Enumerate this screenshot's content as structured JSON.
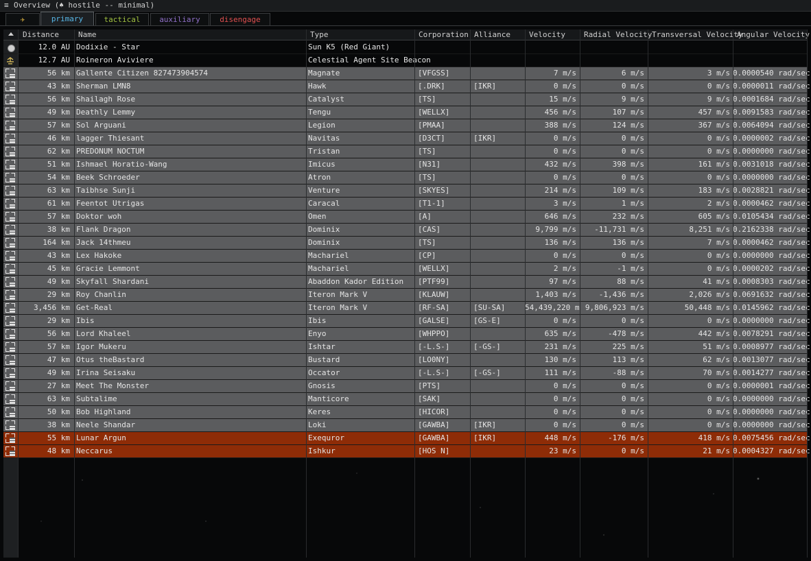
{
  "window": {
    "menu_glyph": "≡",
    "title": "Overview (♠ hostile -- minimal)"
  },
  "tabs": [
    {
      "label": "✈",
      "color": "#d8b040"
    },
    {
      "label": "primary",
      "color": "#58b8e8"
    },
    {
      "label": "tactical",
      "color": "#a0c040"
    },
    {
      "label": "auxiliary",
      "color": "#9070c8"
    },
    {
      "label": "disengage",
      "color": "#e05050"
    }
  ],
  "columns": {
    "distance": "Distance",
    "name": "Name",
    "type": "Type",
    "corporation": "Corporation",
    "alliance": "Alliance",
    "velocity": "Velocity",
    "radial": "Radial Velocity",
    "transversal": "Transversal Velocity",
    "angular": "Angular Velocity"
  },
  "rows": [
    {
      "icon": "star-icon",
      "style": "plain",
      "distance": "12.0 AU",
      "name": "Dodixie - Star",
      "type": "Sun K5 (Red Giant)",
      "corp": "",
      "alliance": "",
      "velocity": "",
      "radial": "",
      "transversal": "",
      "angular": ""
    },
    {
      "icon": "beacon-icon",
      "style": "plain",
      "distance": "12.7 AU",
      "name": "Roineron Aviviere",
      "type": "Celestial Agent Site Beacon",
      "corp": "",
      "alliance": "",
      "velocity": "",
      "radial": "",
      "transversal": "",
      "angular": ""
    },
    {
      "icon": "ship-icon",
      "style": "grey",
      "distance": "56 km",
      "name": "Gallente Citizen 827473904574",
      "type": "Magnate",
      "corp": "[VFGSS]",
      "alliance": "",
      "velocity": "7 m/s",
      "radial": "6 m/s",
      "transversal": "3 m/s",
      "angular": "0.0000540 rad/sec"
    },
    {
      "icon": "ship-icon",
      "style": "grey",
      "distance": "43 km",
      "name": "Sherman LMN8",
      "type": "Hawk",
      "corp": "[.DRK]",
      "alliance": "[IKR]",
      "velocity": "0 m/s",
      "radial": "0 m/s",
      "transversal": "0 m/s",
      "angular": "0.0000011 rad/sec"
    },
    {
      "icon": "ship-icon",
      "style": "grey",
      "distance": "56 km",
      "name": "Shailagh Rose",
      "type": "Catalyst",
      "corp": "[TS]",
      "alliance": "",
      "velocity": "15 m/s",
      "radial": "9 m/s",
      "transversal": "9 m/s",
      "angular": "0.0001684 rad/sec"
    },
    {
      "icon": "ship-icon",
      "style": "grey",
      "distance": "49 km",
      "name": "Deathly Lemmy",
      "type": "Tengu",
      "corp": "[WELLX]",
      "alliance": "",
      "velocity": "456 m/s",
      "radial": "107 m/s",
      "transversal": "457 m/s",
      "angular": "0.0091583 rad/sec"
    },
    {
      "icon": "ship-icon",
      "style": "grey",
      "distance": "57 km",
      "name": "Sol Arguani",
      "type": "Legion",
      "corp": "[PMAA]",
      "alliance": "",
      "velocity": "388 m/s",
      "radial": "124 m/s",
      "transversal": "367 m/s",
      "angular": "0.0064094 rad/sec"
    },
    {
      "icon": "ship-icon",
      "style": "grey",
      "distance": "46 km",
      "name": "lagger Thiesant",
      "type": "Navitas",
      "corp": "[D3CT]",
      "alliance": "[IKR]",
      "velocity": "0 m/s",
      "radial": "0 m/s",
      "transversal": "0 m/s",
      "angular": "0.0000002 rad/sec"
    },
    {
      "icon": "ship-icon",
      "style": "grey",
      "distance": "62 km",
      "name": "PREDONUM NOCTUM",
      "type": "Tristan",
      "corp": "[TS]",
      "alliance": "",
      "velocity": "0 m/s",
      "radial": "0 m/s",
      "transversal": "0 m/s",
      "angular": "0.0000000 rad/sec"
    },
    {
      "icon": "ship-icon",
      "style": "grey",
      "distance": "51 km",
      "name": "Ishmael Horatio-Wang",
      "type": "Imicus",
      "corp": "[N31]",
      "alliance": "",
      "velocity": "432 m/s",
      "radial": "398 m/s",
      "transversal": "161 m/s",
      "angular": "0.0031018 rad/sec"
    },
    {
      "icon": "ship-icon",
      "style": "grey",
      "distance": "54 km",
      "name": "Beek Schroeder",
      "type": "Atron",
      "corp": "[TS]",
      "alliance": "",
      "velocity": "0 m/s",
      "radial": "0 m/s",
      "transversal": "0 m/s",
      "angular": "0.0000000 rad/sec"
    },
    {
      "icon": "ship-icon",
      "style": "grey",
      "distance": "63 km",
      "name": "Taibhse Sunji",
      "type": "Venture",
      "corp": "[SKYES]",
      "alliance": "",
      "velocity": "214 m/s",
      "radial": "109 m/s",
      "transversal": "183 m/s",
      "angular": "0.0028821 rad/sec"
    },
    {
      "icon": "ship-icon",
      "style": "grey",
      "distance": "61 km",
      "name": "Feentot Utrigas",
      "type": "Caracal",
      "corp": "[T1-1]",
      "alliance": "",
      "velocity": "3 m/s",
      "radial": "1 m/s",
      "transversal": "2 m/s",
      "angular": "0.0000462 rad/sec"
    },
    {
      "icon": "ship-icon",
      "style": "grey",
      "distance": "57 km",
      "name": "Doktor woh",
      "type": "Omen",
      "corp": "[A]",
      "alliance": "",
      "velocity": "646 m/s",
      "radial": "232 m/s",
      "transversal": "605 m/s",
      "angular": "0.0105434 rad/sec"
    },
    {
      "icon": "ship-icon",
      "style": "grey",
      "distance": "38 km",
      "name": "Flank Dragon",
      "type": "Dominix",
      "corp": "[CAS]",
      "alliance": "",
      "velocity": "9,799 m/s",
      "radial": "-11,731 m/s",
      "transversal": "8,251 m/s",
      "angular": "0.2162338 rad/sec"
    },
    {
      "icon": "ship-icon",
      "style": "grey",
      "distance": "164 km",
      "name": "Jack 14thmeu",
      "type": "Dominix",
      "corp": "[TS]",
      "alliance": "",
      "velocity": "136 m/s",
      "radial": "136 m/s",
      "transversal": "7 m/s",
      "angular": "0.0000462 rad/sec"
    },
    {
      "icon": "ship-icon",
      "style": "grey",
      "distance": "43 km",
      "name": "Lex Hakoke",
      "type": "Machariel",
      "corp": "[CP]",
      "alliance": "",
      "velocity": "0 m/s",
      "radial": "0 m/s",
      "transversal": "0 m/s",
      "angular": "0.0000000 rad/sec"
    },
    {
      "icon": "ship-icon",
      "style": "grey",
      "distance": "45 km",
      "name": "Gracie Lemmont",
      "type": "Machariel",
      "corp": "[WELLX]",
      "alliance": "",
      "velocity": "2 m/s",
      "radial": "-1 m/s",
      "transversal": "0 m/s",
      "angular": "0.0000202 rad/sec"
    },
    {
      "icon": "ship-icon",
      "style": "grey",
      "distance": "49 km",
      "name": "Skyfall Shardani",
      "type": "Abaddon Kador Edition",
      "corp": "[PTF99]",
      "alliance": "",
      "velocity": "97 m/s",
      "radial": "88 m/s",
      "transversal": "41 m/s",
      "angular": "0.0008303 rad/sec"
    },
    {
      "icon": "ship-icon",
      "style": "grey",
      "distance": "29 km",
      "name": "Roy Chanlin",
      "type": "Iteron Mark V",
      "corp": "[KLAUW]",
      "alliance": "",
      "velocity": "1,403 m/s",
      "radial": "-1,436 m/s",
      "transversal": "2,026 m/s",
      "angular": "0.0691632 rad/sec"
    },
    {
      "icon": "ship-icon",
      "style": "grey",
      "distance": "3,456 km",
      "name": "Get-Real",
      "type": "Iteron Mark V",
      "corp": "[RF-SA]",
      "alliance": "[SU-SA]",
      "velocity": "54,439,220 m",
      "radial": "9,806,923 m/s",
      "transversal": "50,448 m/s",
      "angular": "0.0145962 rad/sec"
    },
    {
      "icon": "ship-icon",
      "style": "grey",
      "distance": "29 km",
      "name": "Ibis",
      "type": "Ibis",
      "corp": "[GALSE]",
      "alliance": "[GS-E]",
      "velocity": "0 m/s",
      "radial": "0 m/s",
      "transversal": "0 m/s",
      "angular": "0.0000000 rad/sec"
    },
    {
      "icon": "ship-icon",
      "style": "grey",
      "distance": "56 km",
      "name": "Lord Khaleel",
      "type": "Enyo",
      "corp": "[WHPPO]",
      "alliance": "",
      "velocity": "635 m/s",
      "radial": "-478 m/s",
      "transversal": "442 m/s",
      "angular": "0.0078291 rad/sec"
    },
    {
      "icon": "ship-icon",
      "style": "grey",
      "distance": "57 km",
      "name": "Igor Mukeru",
      "type": "Ishtar",
      "corp": "[-L.S-]",
      "alliance": "[-GS-]",
      "velocity": "231 m/s",
      "radial": "225 m/s",
      "transversal": "51 m/s",
      "angular": "0.0008977 rad/sec"
    },
    {
      "icon": "ship-icon",
      "style": "grey",
      "distance": "47 km",
      "name": "Otus theBastard",
      "type": "Bustard",
      "corp": "[LO0NY]",
      "alliance": "",
      "velocity": "130 m/s",
      "radial": "113 m/s",
      "transversal": "62 m/s",
      "angular": "0.0013077 rad/sec"
    },
    {
      "icon": "ship-icon",
      "style": "grey",
      "distance": "49 km",
      "name": "Irina Seisaku",
      "type": "Occator",
      "corp": "[-L.S-]",
      "alliance": "[-GS-]",
      "velocity": "111 m/s",
      "radial": "-88 m/s",
      "transversal": "70 m/s",
      "angular": "0.0014277 rad/sec"
    },
    {
      "icon": "ship-icon",
      "style": "grey",
      "distance": "27 km",
      "name": "Meet The Monster",
      "type": "Gnosis",
      "corp": "[PTS]",
      "alliance": "",
      "velocity": "0 m/s",
      "radial": "0 m/s",
      "transversal": "0 m/s",
      "angular": "0.0000001 rad/sec"
    },
    {
      "icon": "ship-icon",
      "style": "grey",
      "distance": "63 km",
      "name": "Subtalime",
      "type": "Manticore",
      "corp": "[SAK]",
      "alliance": "",
      "velocity": "0 m/s",
      "radial": "0 m/s",
      "transversal": "0 m/s",
      "angular": "0.0000000 rad/sec"
    },
    {
      "icon": "ship-icon",
      "style": "grey",
      "distance": "50 km",
      "name": "Bob Highland",
      "type": "Keres",
      "corp": "[HICOR]",
      "alliance": "",
      "velocity": "0 m/s",
      "radial": "0 m/s",
      "transversal": "0 m/s",
      "angular": "0.0000000 rad/sec"
    },
    {
      "icon": "ship-icon",
      "style": "grey",
      "distance": "38 km",
      "name": "Neele Shandar",
      "type": "Loki",
      "corp": "[GAWBA]",
      "alliance": "[IKR]",
      "velocity": "0 m/s",
      "radial": "0 m/s",
      "transversal": "0 m/s",
      "angular": "0.0000000 rad/sec"
    },
    {
      "icon": "ship-icon",
      "style": "orange",
      "distance": "55 km",
      "name": "Lunar Argun",
      "type": "Exequror",
      "corp": "[GAWBA]",
      "alliance": "[IKR]",
      "velocity": "448 m/s",
      "radial": "-176 m/s",
      "transversal": "418 m/s",
      "angular": "0.0075456 rad/sec"
    },
    {
      "icon": "ship-icon",
      "style": "orange",
      "distance": "48 km",
      "name": "Neccarus",
      "type": "Ishkur",
      "corp": "[HOS N]",
      "alliance": "",
      "velocity": "23 m/s",
      "radial": "0 m/s",
      "transversal": "21 m/s",
      "angular": "0.0004327 rad/sec"
    }
  ]
}
